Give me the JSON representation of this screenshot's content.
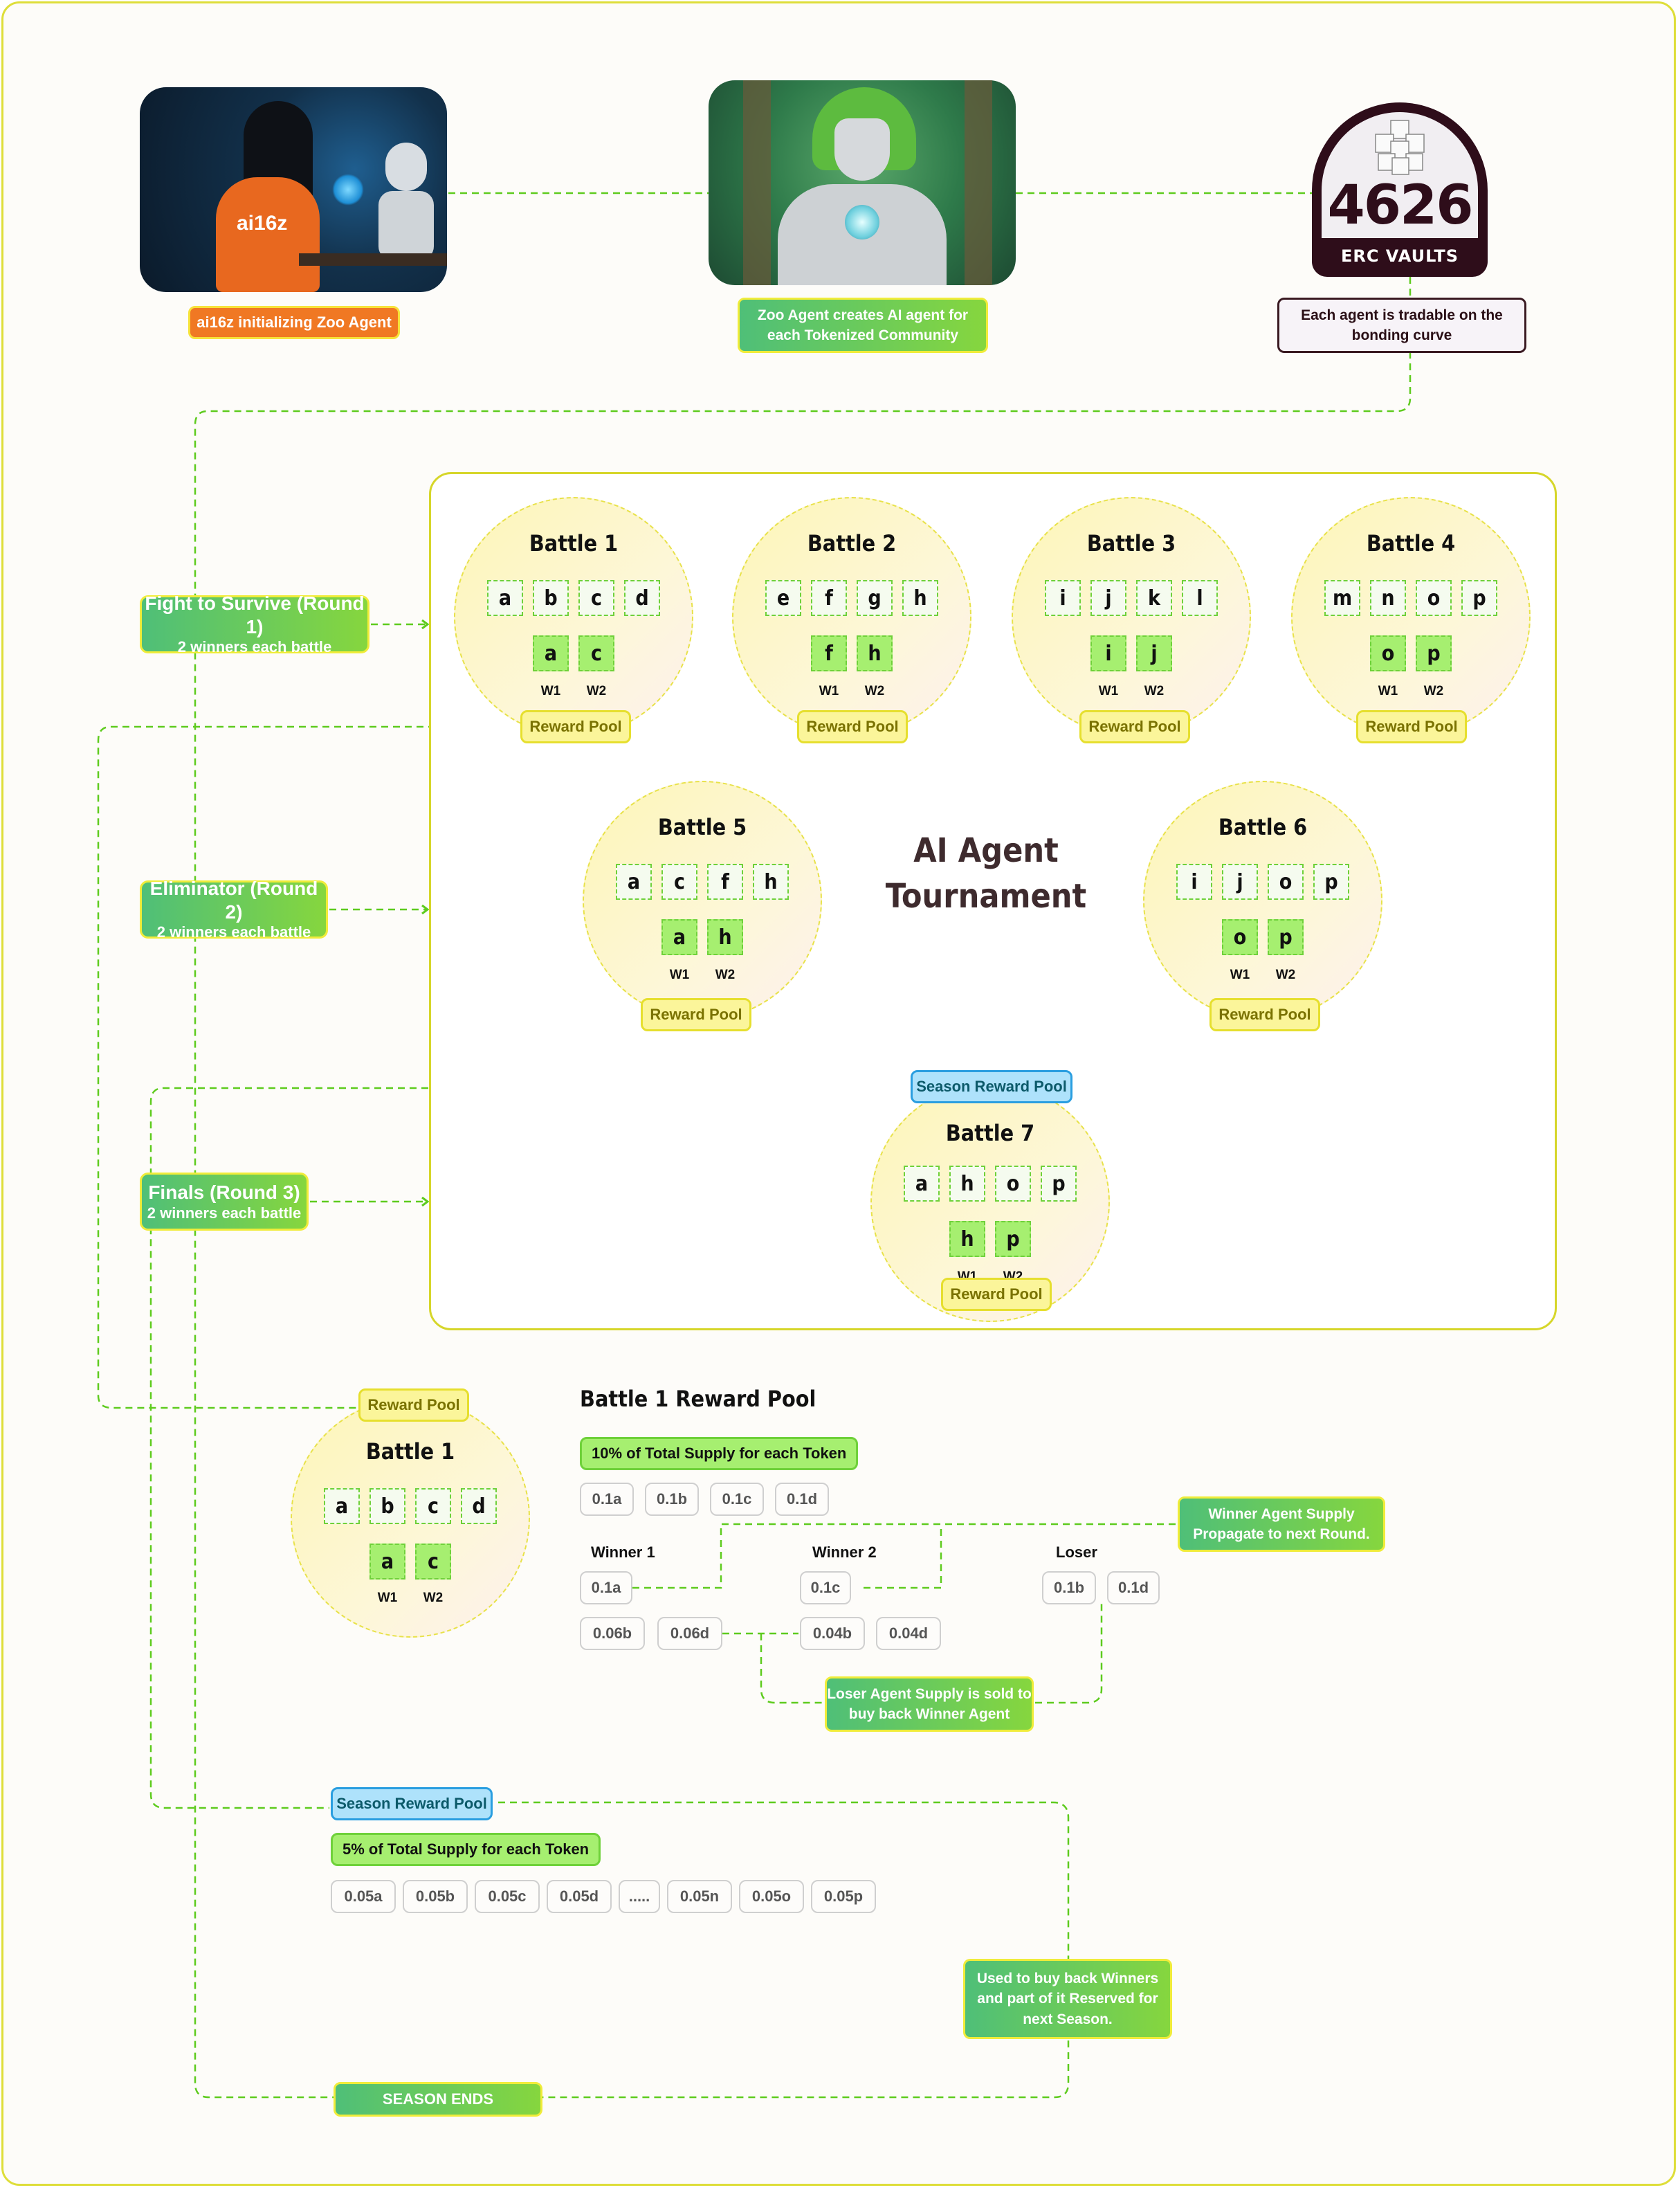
{
  "header": {
    "ai16z_caption": "ai16z initializing Zoo Agent",
    "ai16z_shirt": "ai16z",
    "zoo_caption": "Zoo Agent creates AI agent for each Tokenized  Community",
    "vault_number": "4626",
    "vault_name": "ERC VAULTS",
    "vault_caption": "Each agent is tradable on the bonding curve"
  },
  "rounds": [
    {
      "title": "Fight to Survive (Round 1)",
      "subtitle": "2 winners each battle"
    },
    {
      "title": "Eliminator (Round 2)",
      "subtitle": "2 winners each battle"
    },
    {
      "title": "Finals (Round 3)",
      "subtitle": "2 winners each battle"
    }
  ],
  "tournament": {
    "title_line1": "AI Agent",
    "title_line2": "Tournament",
    "reward_pool_label": "Reward Pool",
    "season_reward_pool_label": "Season Reward Pool",
    "winner_labels": [
      "W1",
      "W2"
    ],
    "battles": [
      {
        "title": "Battle 1",
        "agents": [
          "a",
          "b",
          "c",
          "d"
        ],
        "winners": [
          "a",
          "c"
        ]
      },
      {
        "title": "Battle 2",
        "agents": [
          "e",
          "f",
          "g",
          "h"
        ],
        "winners": [
          "f",
          "h"
        ]
      },
      {
        "title": "Battle  3",
        "agents": [
          "i",
          "j",
          "k",
          "l"
        ],
        "winners": [
          "i",
          "j"
        ]
      },
      {
        "title": "Battle 4",
        "agents": [
          "m",
          "n",
          "o",
          "p"
        ],
        "winners": [
          "o",
          "p"
        ]
      },
      {
        "title": "Battle 5",
        "agents": [
          "a",
          "c",
          "f",
          "h"
        ],
        "winners": [
          "a",
          "h"
        ]
      },
      {
        "title": "Battle  6",
        "agents": [
          "i",
          "j",
          "o",
          "p"
        ],
        "winners": [
          "o",
          "p"
        ]
      },
      {
        "title": "Battle 7",
        "agents": [
          "a",
          "h",
          "o",
          "p"
        ],
        "winners": [
          "h",
          "p"
        ]
      }
    ]
  },
  "detail": {
    "battle": {
      "title": "Battle 1",
      "agents": [
        "a",
        "b",
        "c",
        "d"
      ],
      "winners": [
        "a",
        "c"
      ],
      "reward_pool_label": "Reward Pool"
    },
    "reward_pool_title": "Battle 1 Reward Pool",
    "supply_label": "10% of Total Supply for each Token",
    "supply_chips": [
      "0.1a",
      "0.1b",
      "0.1c",
      "0.1d"
    ],
    "winner1": {
      "label": "Winner 1",
      "own": "0.1a",
      "gains": [
        "0.06b",
        "0.06d"
      ]
    },
    "winner2": {
      "label": "Winner 2",
      "own": "0.1c",
      "gains": [
        "0.04b",
        "0.04d"
      ]
    },
    "loser": {
      "label": "Loser",
      "chips": [
        "0.1b",
        "0.1d"
      ]
    },
    "winner_note": "Winner Agent Supply Propagate to next Round.",
    "loser_note": "Loser Agent Supply is sold to buy back Winner Agent"
  },
  "season": {
    "label": "Season Reward Pool",
    "supply_label": "5% of Total Supply for each Token",
    "chips": [
      "0.05a",
      "0.05b",
      "0.05c",
      "0.05d",
      ".....",
      "0.05n",
      "0.05o",
      "0.05p"
    ],
    "note": "Used to buy back Winners and part of it Reserved for next Season.",
    "end_label": "SEASON ENDS"
  },
  "colors": {
    "connector": "#5ecb1e",
    "accent_green": "#86d63e",
    "reward_yellow": "#fbf59a",
    "season_blue": "#aee2fb",
    "caption_orange": "#f07823",
    "vault_dark": "#2e0d1a"
  }
}
